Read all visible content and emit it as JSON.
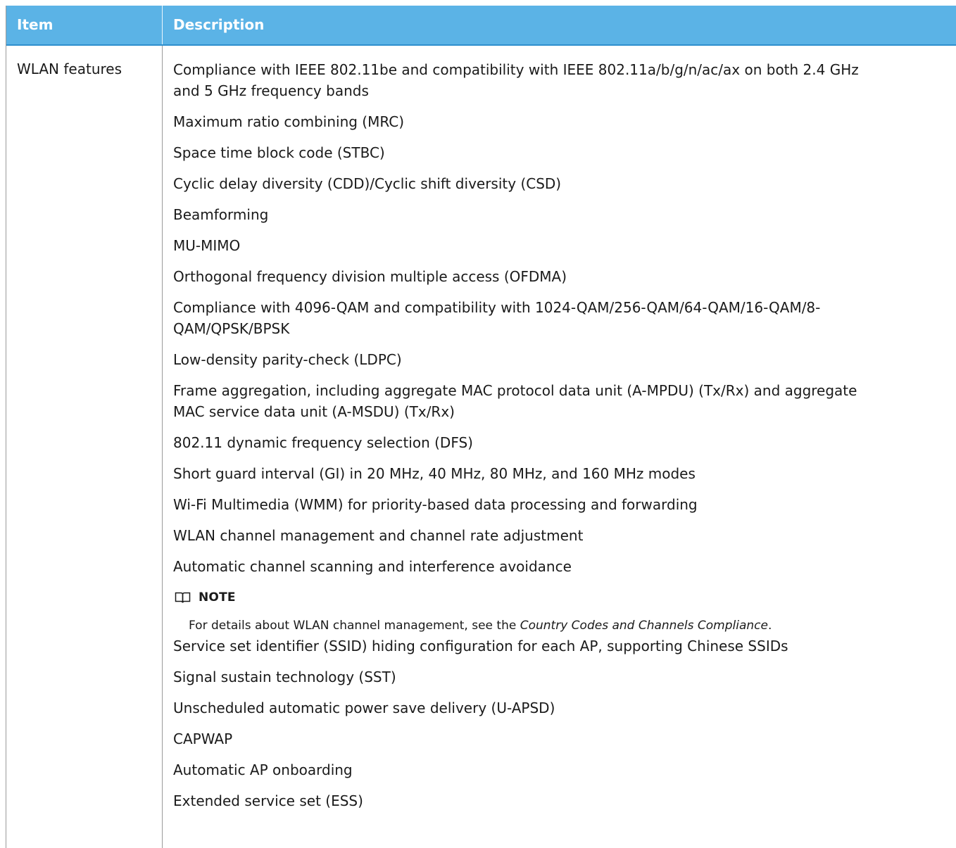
{
  "header": {
    "item": "Item",
    "description": "Description"
  },
  "row": {
    "item": "WLAN features",
    "features": [
      "Compliance with IEEE 802.11be and compatibility with IEEE 802.11a/b/g/n/ac/ax on both 2.4 GHz",
      "and 5 GHz frequency bands",
      "Maximum ratio combining (MRC)",
      "Space time block code (STBC)",
      "Cyclic delay diversity (CDD)/Cyclic shift diversity (CSD)",
      "Beamforming",
      "MU-MIMO",
      "Orthogonal frequency division multiple access (OFDMA)",
      "Compliance with 4096-QAM and compatibility with 1024-QAM/256-QAM/64-QAM/16-QAM/8-",
      "QAM/QPSK/BPSK",
      "Low-density parity-check (LDPC)",
      "Frame aggregation, including aggregate MAC protocol data unit (A-MPDU) (Tx/Rx) and aggregate",
      "MAC service data unit (A-MSDU) (Tx/Rx)",
      "802.11 dynamic frequency selection (DFS)",
      "Short guard interval (GI) in 20 MHz, 40 MHz, 80 MHz, and 160 MHz modes",
      "Wi-Fi Multimedia (WMM) for priority-based data processing and forwarding",
      "WLAN channel management and channel rate adjustment",
      "Automatic channel scanning and interference avoidance"
    ],
    "note": {
      "label": "NOTE",
      "text_before": "For details about WLAN channel management, see the ",
      "text_italic": "Country Codes and Channels Compliance",
      "text_after": "."
    },
    "features_after_note": [
      "Service set identifier (SSID) hiding configuration for each AP, supporting Chinese SSIDs",
      "Signal sustain technology (SST)",
      "Unscheduled automatic power save delivery (U-APSD)",
      "CAPWAP",
      "Automatic AP onboarding",
      "Extended service set (ESS)"
    ]
  }
}
